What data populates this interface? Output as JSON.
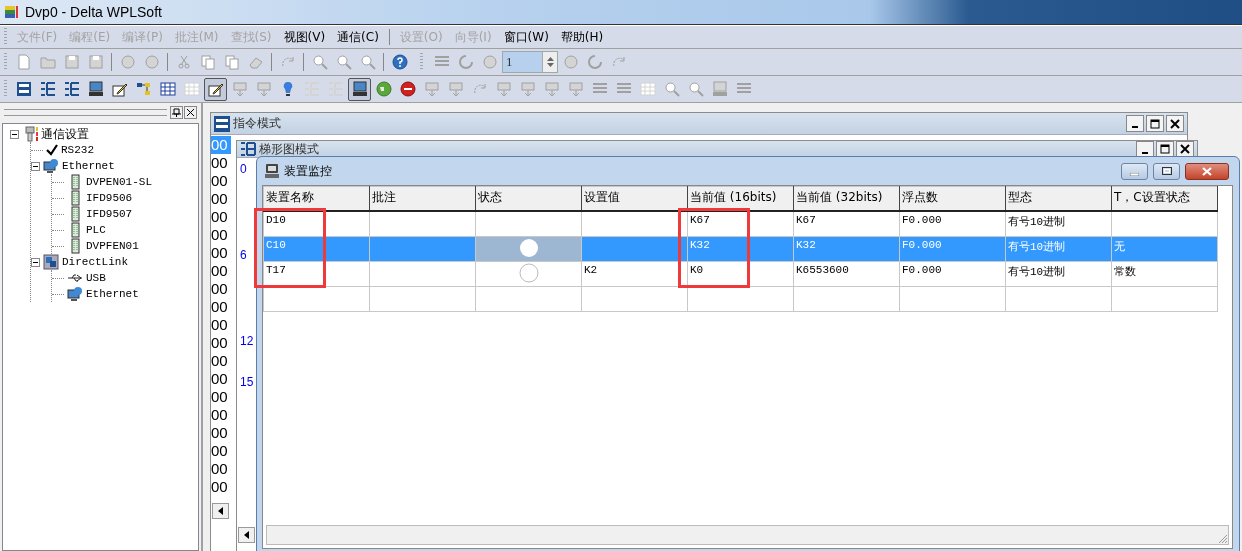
{
  "window": {
    "title": "Dvp0 - Delta WPLSoft"
  },
  "menu": [
    {
      "label": "文件(F)",
      "disabled": true
    },
    {
      "label": "编程(E)",
      "disabled": true
    },
    {
      "label": "编译(P)",
      "disabled": true
    },
    {
      "label": "批注(M)",
      "disabled": true
    },
    {
      "label": "查找(S)",
      "disabled": true
    },
    {
      "label": "视图(V)",
      "disabled": false
    },
    {
      "label": "通信(C)",
      "disabled": false
    },
    {
      "kind": "separator"
    },
    {
      "label": "设置(O)",
      "disabled": true
    },
    {
      "label": "向导(I)",
      "disabled": true
    },
    {
      "label": "窗口(W)",
      "disabled": false
    },
    {
      "label": "帮助(H)",
      "disabled": false
    }
  ],
  "toolbars": [
    [
      {
        "kind": "button",
        "disabled": true
      },
      {
        "kind": "button",
        "disabled": true
      },
      {
        "kind": "button",
        "disabled": true
      },
      {
        "kind": "button",
        "disabled": true
      },
      {
        "kind": "separator"
      },
      {
        "kind": "button",
        "disabled": true
      },
      {
        "kind": "button",
        "disabled": true
      },
      {
        "kind": "separator"
      },
      {
        "kind": "button",
        "disabled": true
      },
      {
        "kind": "button",
        "disabled": true
      },
      {
        "kind": "button",
        "disabled": true
      },
      {
        "kind": "button",
        "disabled": true
      },
      {
        "kind": "separator"
      },
      {
        "kind": "button",
        "disabled": true
      },
      {
        "kind": "separator"
      },
      {
        "kind": "button",
        "disabled": true
      },
      {
        "kind": "button",
        "disabled": true
      },
      {
        "kind": "button",
        "disabled": true
      },
      {
        "kind": "separator"
      },
      {
        "kind": "button",
        "disabled": false
      },
      {
        "kind": "gripper"
      },
      {
        "kind": "button",
        "disabled": true
      },
      {
        "kind": "button",
        "disabled": true
      },
      {
        "kind": "button",
        "disabled": true
      },
      {
        "kind": "spin",
        "value": "1"
      },
      {
        "kind": "button",
        "disabled": true
      },
      {
        "kind": "button",
        "disabled": true
      },
      {
        "kind": "button",
        "disabled": true
      }
    ],
    [
      {
        "kind": "button",
        "disabled": false,
        "pressed": false
      },
      {
        "kind": "button",
        "disabled": false,
        "pressed": false
      },
      {
        "kind": "button",
        "disabled": false,
        "pressed": false
      },
      {
        "kind": "button",
        "disabled": false,
        "pressed": false
      },
      {
        "kind": "button",
        "disabled": false,
        "pressed": false
      },
      {
        "kind": "button",
        "disabled": false,
        "pressed": false
      },
      {
        "kind": "button",
        "disabled": false,
        "pressed": false
      },
      {
        "kind": "button",
        "disabled": true,
        "pressed": false
      },
      {
        "kind": "button",
        "disabled": false,
        "pressed": true
      },
      {
        "kind": "button",
        "disabled": true,
        "pressed": false
      },
      {
        "kind": "button",
        "disabled": true,
        "pressed": false
      },
      {
        "kind": "button",
        "disabled": false,
        "pressed": false
      },
      {
        "kind": "button",
        "disabled": true,
        "pressed": false
      },
      {
        "kind": "button",
        "disabled": true,
        "pressed": false
      },
      {
        "kind": "button",
        "disabled": false,
        "pressed": true
      },
      {
        "kind": "button",
        "disabled": false,
        "pressed": false
      },
      {
        "kind": "button",
        "disabled": false,
        "pressed": false
      },
      {
        "kind": "button",
        "disabled": true,
        "pressed": false
      },
      {
        "kind": "button",
        "disabled": true,
        "pressed": false
      },
      {
        "kind": "button",
        "disabled": true,
        "pressed": false
      },
      {
        "kind": "button",
        "disabled": true,
        "pressed": false
      },
      {
        "kind": "button",
        "disabled": true,
        "pressed": false
      },
      {
        "kind": "button",
        "disabled": true,
        "pressed": false
      },
      {
        "kind": "button",
        "disabled": true,
        "pressed": false
      },
      {
        "kind": "button",
        "disabled": true,
        "pressed": false
      },
      {
        "kind": "button",
        "disabled": true,
        "pressed": false
      },
      {
        "kind": "button",
        "disabled": true,
        "pressed": false
      },
      {
        "kind": "button",
        "disabled": true,
        "pressed": false
      },
      {
        "kind": "button",
        "disabled": true,
        "pressed": false
      },
      {
        "kind": "button",
        "disabled": true,
        "pressed": false
      },
      {
        "kind": "button",
        "disabled": true,
        "pressed": false
      }
    ]
  ],
  "comm_panel": {
    "tree": [
      {
        "label": "通信设置",
        "kind": "port",
        "expanded": true,
        "children": [
          {
            "label": "RS232",
            "kind": "item",
            "selected": true
          },
          {
            "label": "Ethernet",
            "kind": "network",
            "expanded": true,
            "children": [
              {
                "label": "DVPEN01-SL",
                "kind": "module"
              },
              {
                "label": "IFD9506",
                "kind": "module"
              },
              {
                "label": "IFD9507",
                "kind": "module"
              },
              {
                "label": "PLC",
                "kind": "module"
              },
              {
                "label": "DVPFEN01",
                "kind": "module"
              }
            ]
          },
          {
            "label": "DirectLink",
            "kind": "link",
            "expanded": true,
            "children": [
              {
                "label": "USB",
                "kind": "usb"
              },
              {
                "label": "Ethernet",
                "kind": "network"
              }
            ]
          }
        ]
      }
    ]
  },
  "instruction_window": {
    "title": "指令模式",
    "lines": [
      {
        "text": "00",
        "selected": true
      },
      {
        "text": "00",
        "selected": false
      },
      {
        "text": "00",
        "selected": false
      },
      {
        "text": "00",
        "selected": false
      },
      {
        "text": "00",
        "selected": false
      },
      {
        "text": "00",
        "selected": false
      },
      {
        "text": "00",
        "selected": false
      },
      {
        "text": "00",
        "selected": false
      },
      {
        "text": "00",
        "selected": false
      },
      {
        "text": "00",
        "selected": false
      },
      {
        "text": "00",
        "selected": false
      },
      {
        "text": "00",
        "selected": false
      },
      {
        "text": "00",
        "selected": false
      },
      {
        "text": "00",
        "selected": false
      },
      {
        "text": "00",
        "selected": false
      },
      {
        "text": "00",
        "selected": false
      },
      {
        "text": "00",
        "selected": false
      },
      {
        "text": "00",
        "selected": false
      },
      {
        "text": "00",
        "selected": false
      },
      {
        "text": "00",
        "selected": false
      }
    ]
  },
  "ladder_window": {
    "title": "梯形图模式",
    "row_numbers": [
      "0",
      "6",
      "12",
      "15"
    ]
  },
  "monitor_window": {
    "title": "装置监控",
    "columns": [
      {
        "label": "装置名称",
        "highlighted": true
      },
      {
        "label": "批注",
        "highlighted": false
      },
      {
        "label": "状态",
        "highlighted": false
      },
      {
        "label": "设置值",
        "highlighted": false
      },
      {
        "label": "当前值 (16bits)",
        "highlighted": true
      },
      {
        "label": "当前值 (32bits)",
        "highlighted": false
      },
      {
        "label": "浮点数",
        "highlighted": false
      },
      {
        "label": "型态",
        "highlighted": false
      },
      {
        "label": "T，C设置状态",
        "highlighted": false
      }
    ],
    "rows": [
      {
        "selected": false,
        "lamp_shown": false,
        "cells": [
          "D10",
          null,
          null,
          null,
          "K67",
          "K67",
          "F0.000",
          "有号10进制",
          null
        ]
      },
      {
        "selected": true,
        "lamp_shown": true,
        "lamp_on": true,
        "cells": [
          "C10",
          null,
          null,
          null,
          "K32",
          "K32",
          "F0.000",
          "有号10进制",
          "无"
        ]
      },
      {
        "selected": false,
        "lamp_shown": true,
        "lamp_on": false,
        "cells": [
          "T17",
          null,
          null,
          "K2",
          "K0",
          "K6553600",
          "F0.000",
          "有号10进制",
          "常数"
        ]
      }
    ]
  }
}
